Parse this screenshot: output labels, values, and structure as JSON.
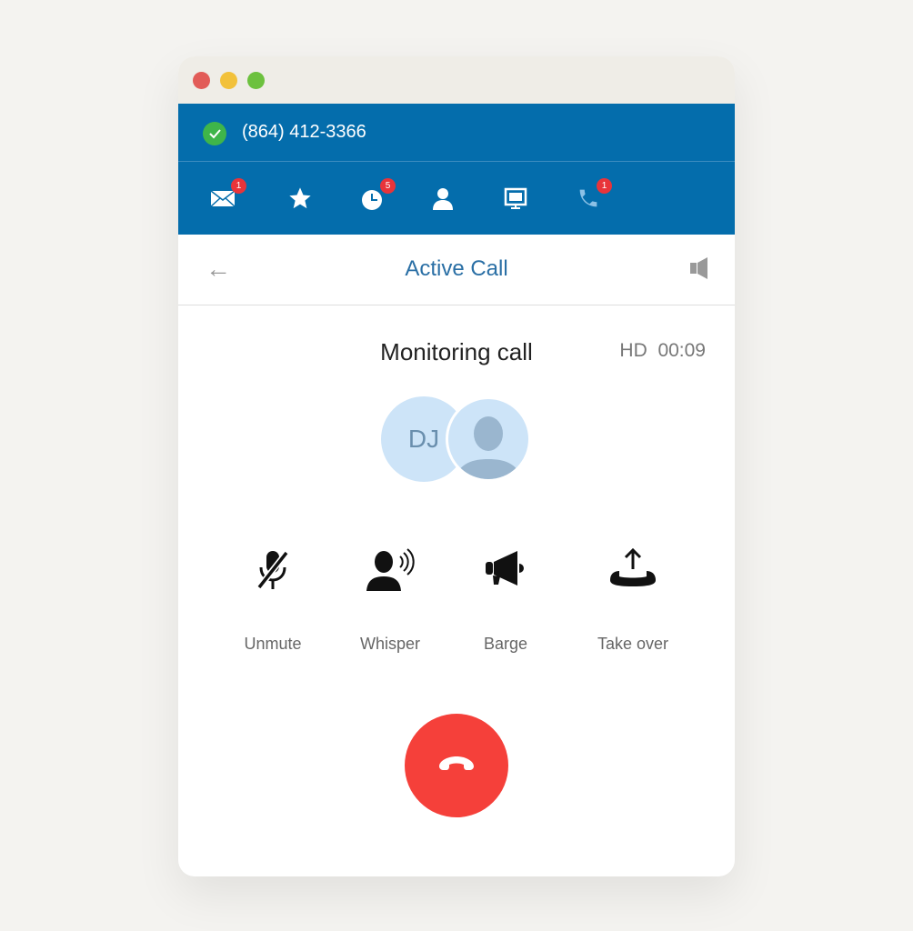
{
  "window": {
    "controls": {
      "close": "#e25c58",
      "minimize": "#f2c13a",
      "zoom": "#6cc13e"
    }
  },
  "status": {
    "phone_number": "(864) 412-3366",
    "status_icon": "check-circle-icon",
    "status_color": "#3fb54a"
  },
  "nav": [
    {
      "icon": "mail-icon",
      "badge": "1"
    },
    {
      "icon": "star-icon",
      "badge": null
    },
    {
      "icon": "history-clock-icon",
      "badge": "5"
    },
    {
      "icon": "contact-icon",
      "badge": null
    },
    {
      "icon": "monitor-icon",
      "badge": null
    },
    {
      "icon": "phone-icon",
      "badge": "1"
    }
  ],
  "header": {
    "title": "Active Call",
    "back_icon": "arrow-left-icon",
    "speaker_icon": "speaker-icon"
  },
  "call": {
    "title": "Monitoring call",
    "quality": "HD",
    "duration": "00:09",
    "participants": [
      {
        "initials": "DJ"
      },
      {
        "avatar": "person-silhouette-icon"
      }
    ]
  },
  "actions": [
    {
      "label": "Unmute",
      "icon": "mic-off-icon"
    },
    {
      "label": "Whisper",
      "icon": "whisper-icon"
    },
    {
      "label": "Barge",
      "icon": "megaphone-icon"
    },
    {
      "label": "Take over",
      "icon": "take-over-icon"
    }
  ],
  "hangup": {
    "icon": "hang-up-icon",
    "color": "#f5403a"
  },
  "colors": {
    "brand": "#046dac",
    "title": "#2a6fa5"
  }
}
